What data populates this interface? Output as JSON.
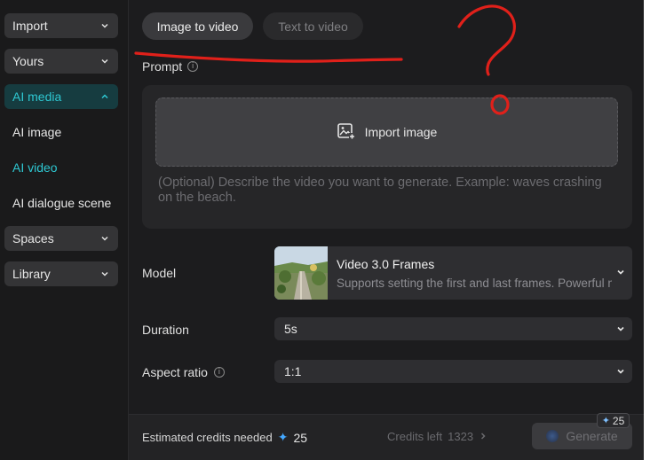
{
  "sidebar": {
    "items": [
      {
        "label": "Import",
        "type": "group",
        "state": "collapsed"
      },
      {
        "label": "Yours",
        "type": "group",
        "state": "collapsed"
      },
      {
        "label": "AI media",
        "type": "group",
        "state": "expanded"
      },
      {
        "label": "AI image",
        "type": "sub"
      },
      {
        "label": "AI video",
        "type": "sub",
        "active": true
      },
      {
        "label": "AI dialogue scene",
        "type": "sub"
      },
      {
        "label": "Spaces",
        "type": "group",
        "state": "collapsed"
      },
      {
        "label": "Library",
        "type": "group",
        "state": "collapsed"
      }
    ]
  },
  "tabs": {
    "image_to_video": "Image to video",
    "text_to_video": "Text to video",
    "selected": "image_to_video"
  },
  "prompt": {
    "label": "Prompt",
    "import_label": "Import image",
    "placeholder": "(Optional) Describe the video you want to generate. Example: waves crashing on the beach."
  },
  "model": {
    "label": "Model",
    "name": "Video 3.0 Frames",
    "description": "Supports setting the first and last frames. Powerful motion and control."
  },
  "duration": {
    "label": "Duration",
    "value": "5s"
  },
  "aspect_ratio": {
    "label": "Aspect ratio",
    "value": "1:1"
  },
  "footer": {
    "estimated_label": "Estimated credits needed",
    "estimated_value": "25",
    "credits_left_label": "Credits left",
    "credits_left_value": "1323",
    "generate_label": "Generate",
    "generate_badge": "25"
  },
  "colors": {
    "accent": "#2ec7d1",
    "annotation": "#e0201a",
    "sparkle": "#44a8ff"
  },
  "icons": [
    "chevron-down-icon",
    "chevron-up-icon",
    "info-icon",
    "image-plus-icon",
    "sparkle-icon",
    "chevron-right-icon"
  ]
}
